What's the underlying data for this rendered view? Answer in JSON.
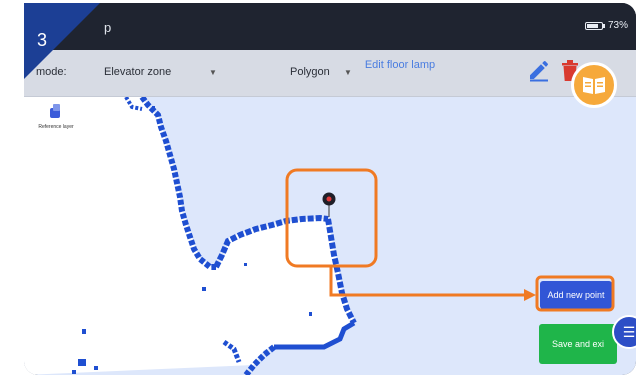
{
  "step": {
    "number": "3"
  },
  "status_bar": {
    "app_title": "p",
    "battery_text": "73%"
  },
  "toolbar": {
    "mode_label": "mode:",
    "mode_value": "Elevator zone",
    "shape_value": "Polygon",
    "edit_link": "Edit floor lamp"
  },
  "reference_layer": {
    "label": "Reference layer"
  },
  "actions": {
    "add_new_point": "Add new point",
    "save_and_exit": "Save and exi"
  },
  "icons": {
    "pencil": "pencil-icon",
    "trash": "trash-icon",
    "guide": "book-icon",
    "map_pin": "map-pin-icon",
    "menu": "menu-icon"
  },
  "colors": {
    "step_tab": "#1c3f95",
    "highlight": "#f07a23",
    "map_wall": "#1f4fd1",
    "map_background": "#dde7fb",
    "add_button": "#3156d6",
    "save_button": "#1fb54a"
  }
}
